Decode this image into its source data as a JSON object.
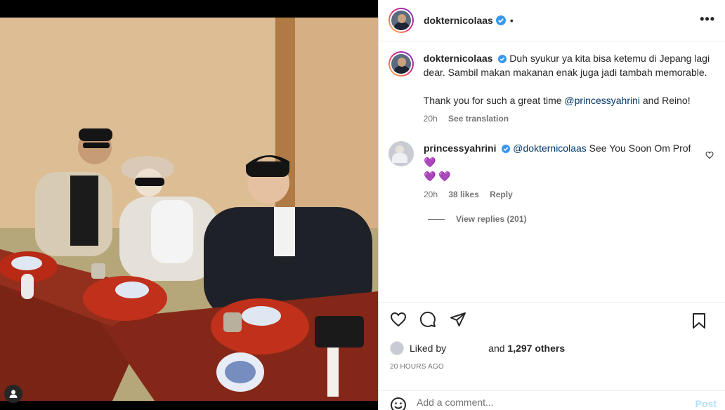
{
  "post": {
    "author": "dokternicolaas",
    "header_dot": "•",
    "more_label": "•••"
  },
  "caption": {
    "author": "dokternicolaas",
    "text": "Duh syukur ya kita bisa ketemu di Jepang lagi dear. Sambil makan makanan enak juga jadi tambah memorable.",
    "text2_before": "Thank you for such a great time ",
    "text2_mention": "@princessyahrini",
    "text2_after": " and Reino!",
    "time": "20h",
    "see_translation": "See translation"
  },
  "comment": {
    "author": "princessyahrini",
    "mention": "@dokternicolaas",
    "text": " See You Soon Om Prof ",
    "emoji_line1": "💜",
    "emoji_line2": "💜 💜",
    "time": "20h",
    "likes": "38 likes",
    "reply": "Reply",
    "view_replies": "View replies (201)"
  },
  "likes": {
    "prefix": "Liked by",
    "connector": "and",
    "count": "1,297 others"
  },
  "time_ago": "20 HOURS AGO",
  "composer": {
    "placeholder": "Add a comment...",
    "post_label": "Post"
  },
  "colors": {
    "verified": "#3897f0",
    "mention": "#00376b",
    "post_disabled": "#b2dffc"
  }
}
